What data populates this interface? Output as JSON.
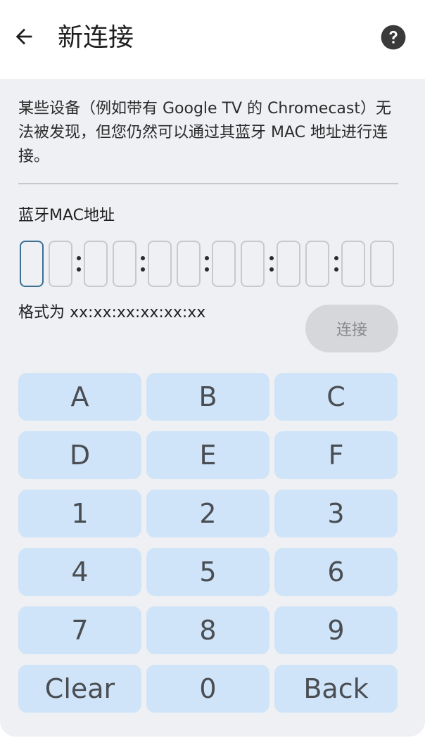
{
  "app_bar": {
    "title": "新连接",
    "back_icon": "arrow-left-icon",
    "help_icon": "help-circle-icon"
  },
  "content": {
    "description": "某些设备（例如带有 Google TV 的 Chromecast）无法被发现，但您仍然可以通过其蓝牙 MAC 地址进行连接。",
    "mac_label": "蓝牙MAC地址",
    "mac_digits": [
      "",
      "",
      "",
      "",
      "",
      "",
      "",
      "",
      "",
      "",
      "",
      ""
    ],
    "format_hint": "格式为 xx:xx:xx:xx:xx:xx",
    "connect_label": "连接"
  },
  "keypad": {
    "rows": [
      [
        "A",
        "B",
        "C"
      ],
      [
        "D",
        "E",
        "F"
      ],
      [
        "1",
        "2",
        "3"
      ],
      [
        "4",
        "5",
        "6"
      ],
      [
        "7",
        "8",
        "9"
      ],
      [
        "Clear",
        "0",
        "Back"
      ]
    ]
  },
  "colors": {
    "key_bg": "#cfe4f8",
    "card_bg": "#eef0f3",
    "focus_border": "#3b6f94",
    "disabled_btn_bg": "#d6d7da"
  }
}
